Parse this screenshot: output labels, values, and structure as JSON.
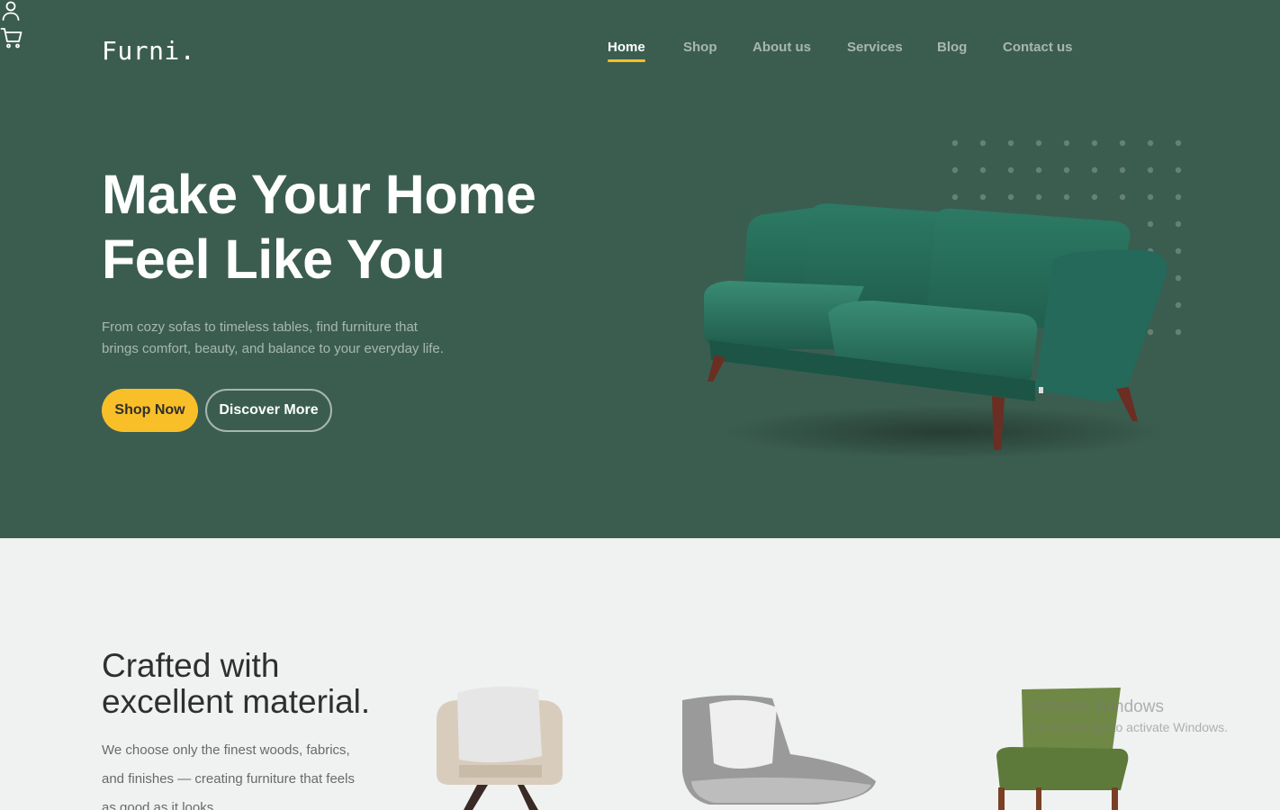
{
  "header": {
    "logo": "Furni."
  },
  "nav": {
    "items": [
      {
        "label": "Home",
        "active": true
      },
      {
        "label": "Shop",
        "active": false
      },
      {
        "label": "About us",
        "active": false
      },
      {
        "label": "Services",
        "active": false
      },
      {
        "label": "Blog",
        "active": false
      },
      {
        "label": "Contact us",
        "active": false
      }
    ],
    "icons": [
      "user-icon",
      "cart-icon"
    ]
  },
  "hero": {
    "title_line1": "Make Your Home",
    "title_line2": "Feel Like You",
    "lead_line1": "From cozy sofas to timeless tables, find furniture that",
    "lead_line2": "brings comfort, beauty, and balance to your everyday life.",
    "primary_button": "Shop Now",
    "secondary_button": "Discover More"
  },
  "materials": {
    "title_line1": "Crafted with",
    "title_line2": "excellent material.",
    "text": "We choose only the finest woods, fabrics, and finishes — creating furniture that feels as good as it looks."
  },
  "watermark": {
    "line1": "Activate Windows",
    "line2": "Go to Settings to activate Windows."
  },
  "colors": {
    "hero_bg": "#3b5d50",
    "accent": "#f9bf29",
    "page_bg": "#eff2f1"
  }
}
